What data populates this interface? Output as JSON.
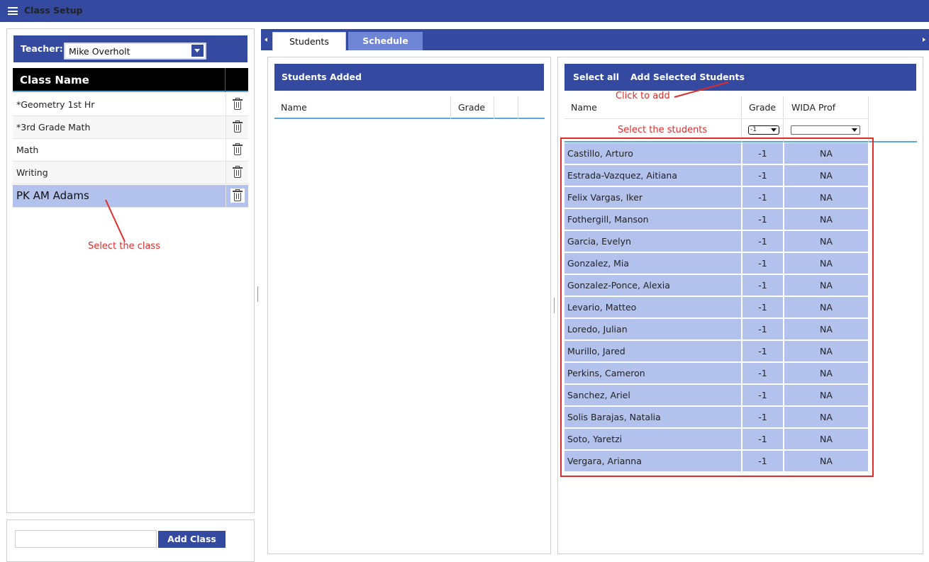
{
  "app": {
    "title": "Class Setup"
  },
  "teacher": {
    "label": "Teacher:",
    "selected": "Mike Overholt"
  },
  "class_table": {
    "header": "Class Name",
    "rows": [
      {
        "name": "*Geometry 1st Hr"
      },
      {
        "name": "*3rd Grade Math"
      },
      {
        "name": "Math"
      },
      {
        "name": "Writing"
      },
      {
        "name": "PK AM Adams"
      }
    ]
  },
  "add_class": {
    "input_value": "",
    "button_label": "Add Class"
  },
  "tabs": [
    {
      "label": "Students"
    },
    {
      "label": "Schedule"
    }
  ],
  "students_added": {
    "title": "Students Added",
    "columns": [
      "Name",
      "Grade"
    ]
  },
  "available": {
    "actions": {
      "select_all": "Select all",
      "add_selected": "Add Selected Students"
    },
    "columns": [
      "Name",
      "Grade",
      "WIDA Prof"
    ],
    "filters": {
      "grade": "-1",
      "wida": ""
    },
    "rows": [
      {
        "name": "Castillo, Arturo",
        "grade": "-1",
        "wida": "NA"
      },
      {
        "name": "Estrada-Vazquez, Aitiana",
        "grade": "-1",
        "wida": "NA"
      },
      {
        "name": "Felix Vargas, Iker",
        "grade": "-1",
        "wida": "NA"
      },
      {
        "name": "Fothergill, Manson",
        "grade": "-1",
        "wida": "NA"
      },
      {
        "name": "Garcia, Evelyn",
        "grade": "-1",
        "wida": "NA"
      },
      {
        "name": "Gonzalez, Mia",
        "grade": "-1",
        "wida": "NA"
      },
      {
        "name": "Gonzalez-Ponce, Alexia",
        "grade": "-1",
        "wida": "NA"
      },
      {
        "name": "Levario, Matteo",
        "grade": "-1",
        "wida": "NA"
      },
      {
        "name": "Loredo, Julian",
        "grade": "-1",
        "wida": "NA"
      },
      {
        "name": "Murillo, Jared",
        "grade": "-1",
        "wida": "NA"
      },
      {
        "name": "Perkins, Cameron",
        "grade": "-1",
        "wida": "NA"
      },
      {
        "name": "Sanchez, Ariel",
        "grade": "-1",
        "wida": "NA"
      },
      {
        "name": "Solis Barajas, Natalia",
        "grade": "-1",
        "wida": "NA"
      },
      {
        "name": "Soto, Yaretzi",
        "grade": "-1",
        "wida": "NA"
      },
      {
        "name": "Vergara, Arianna",
        "grade": "-1",
        "wida": "NA"
      }
    ]
  },
  "annotations": {
    "select_class": "Select the class",
    "click_to_add": "Click to add",
    "select_students": "Select the students"
  },
  "colors": {
    "primary": "#344aa0",
    "selected_row": "#b3c2ec",
    "annotation": "#e02b2b",
    "tab_inactive": "#6f86d6"
  }
}
